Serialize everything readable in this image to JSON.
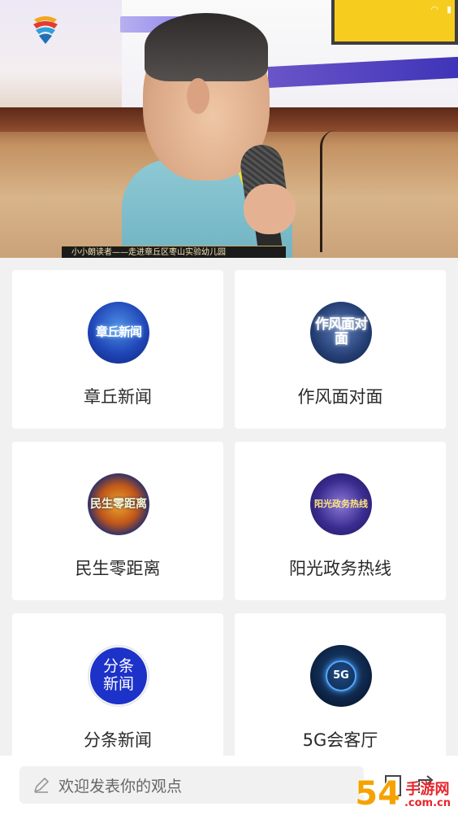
{
  "video": {
    "caption": "小小朗读者——走进章丘区枣山实验幼儿园"
  },
  "grid": {
    "items": [
      {
        "label": "章丘新闻",
        "icon": "zhangqiu-news-icon",
        "icon_text": "章丘新闻"
      },
      {
        "label": "作风面对面",
        "icon": "zuofeng-face-to-face-icon",
        "icon_text": "作风面对面"
      },
      {
        "label": "民生零距离",
        "icon": "minsheng-zero-distance-icon",
        "icon_text": "民生零距离"
      },
      {
        "label": "阳光政务热线",
        "icon": "sunshine-gov-hotline-icon",
        "icon_text": "阳光政务热线"
      },
      {
        "label": "分条新闻",
        "icon": "split-news-icon",
        "icon_text_1": "分条",
        "icon_text_2": "新闻"
      },
      {
        "label": "5G会客厅",
        "icon": "5g-lounge-icon",
        "icon_text": "5G"
      }
    ]
  },
  "comment": {
    "placeholder": "欢迎发表你的观点"
  },
  "watermark": {
    "number": "54",
    "text": "手游网",
    "domain": ".com.cn"
  },
  "colors": {
    "card_bg": "#ffffff",
    "page_bg": "#f1f1f1",
    "label": "#2a2a2a",
    "accent_blue": "#1c32c9"
  }
}
